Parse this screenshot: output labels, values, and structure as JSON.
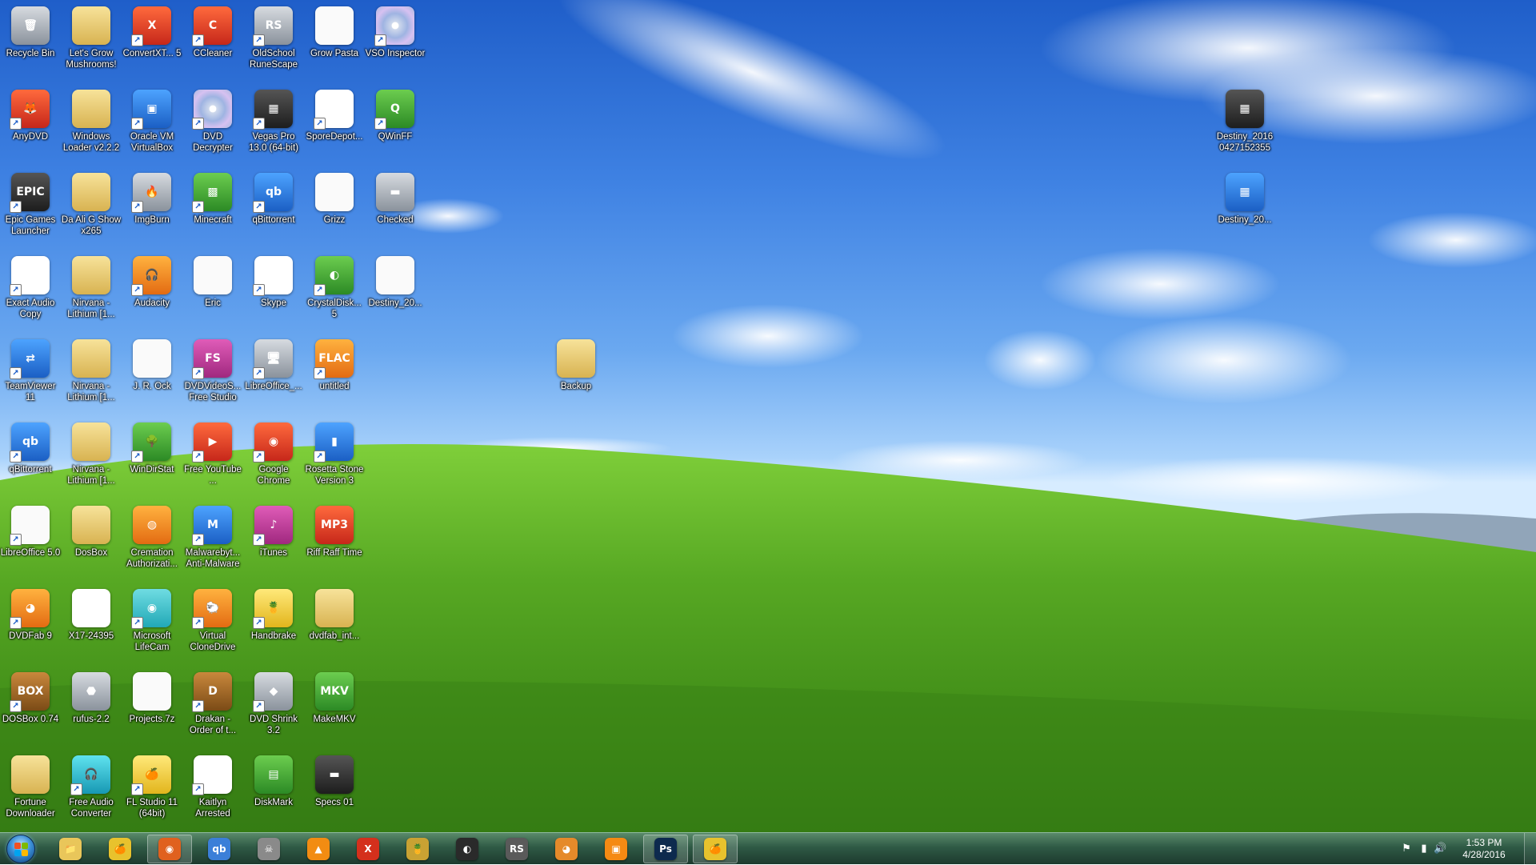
{
  "desktop": {
    "icons": [
      {
        "label": "Recycle Bin",
        "glyph": "🗑",
        "style": "gray",
        "shortcut": false
      },
      {
        "label": "Let's Grow Mushrooms!",
        "glyph": "",
        "style": "folder",
        "shortcut": false
      },
      {
        "label": "ConvertXT... 5",
        "glyph": "X",
        "style": "red",
        "shortcut": true
      },
      {
        "label": "CCleaner",
        "glyph": "C",
        "style": "red",
        "shortcut": true
      },
      {
        "label": "OldSchool RuneScape",
        "glyph": "RS",
        "style": "gray",
        "shortcut": true
      },
      {
        "label": "Grow Pasta",
        "glyph": "",
        "style": "file",
        "shortcut": false
      },
      {
        "label": "VSO Inspector",
        "glyph": "",
        "style": "disc",
        "shortcut": true
      },
      {
        "label": "AnyDVD",
        "glyph": "🦊",
        "style": "red",
        "shortcut": true
      },
      {
        "label": "Windows Loader v2.2.2",
        "glyph": "",
        "style": "folder",
        "shortcut": false
      },
      {
        "label": "Oracle VM VirtualBox",
        "glyph": "▣",
        "style": "blue",
        "shortcut": true
      },
      {
        "label": "DVD Decrypter",
        "glyph": "",
        "style": "disc",
        "shortcut": true
      },
      {
        "label": "Vegas Pro 13.0 (64-bit)",
        "glyph": "▦",
        "style": "dark",
        "shortcut": true
      },
      {
        "label": "SporeDepot...",
        "glyph": "✎",
        "style": "white",
        "shortcut": true
      },
      {
        "label": "QWinFF",
        "glyph": "Q",
        "style": "green",
        "shortcut": true
      },
      {
        "label": "Epic Games Launcher",
        "glyph": "EPIC",
        "style": "dark",
        "shortcut": true
      },
      {
        "label": "Da Ali G Show x265",
        "glyph": "",
        "style": "folder",
        "shortcut": false
      },
      {
        "label": "ImgBurn",
        "glyph": "🔥",
        "style": "gray",
        "shortcut": true
      },
      {
        "label": "Minecraft",
        "glyph": "▩",
        "style": "green",
        "shortcut": true
      },
      {
        "label": "qBittorrent",
        "glyph": "qb",
        "style": "blue",
        "shortcut": true
      },
      {
        "label": "Grizz",
        "glyph": "",
        "style": "file",
        "shortcut": false
      },
      {
        "label": "Checked",
        "glyph": "▬",
        "style": "gray",
        "shortcut": false
      },
      {
        "label": "Exact Audio Copy",
        "glyph": "EAC",
        "style": "white",
        "shortcut": true
      },
      {
        "label": "Nirvana - Lithium [1...",
        "glyph": "",
        "style": "folder",
        "shortcut": false
      },
      {
        "label": "Audacity",
        "glyph": "🎧",
        "style": "orange",
        "shortcut": true
      },
      {
        "label": "Eric",
        "glyph": "",
        "style": "file",
        "shortcut": false
      },
      {
        "label": "Skype",
        "glyph": "▦",
        "style": "white",
        "shortcut": true
      },
      {
        "label": "CrystalDisk... 5",
        "glyph": "◐",
        "style": "green",
        "shortcut": true
      },
      {
        "label": "Destiny_20...",
        "glyph": "",
        "style": "file",
        "shortcut": false
      },
      {
        "label": "TeamViewer 11",
        "glyph": "⇄",
        "style": "blue",
        "shortcut": true
      },
      {
        "label": "Nirvana - Lithium [1...",
        "glyph": "",
        "style": "folder",
        "shortcut": false
      },
      {
        "label": "J. R. Ock",
        "glyph": "",
        "style": "file",
        "shortcut": false
      },
      {
        "label": "DVDVideoS... Free Studio",
        "glyph": "FS",
        "style": "purple",
        "shortcut": true
      },
      {
        "label": "LibreOffice_...",
        "glyph": "🖥",
        "style": "gray",
        "shortcut": true
      },
      {
        "label": "untitled",
        "glyph": "FLAC",
        "style": "orange",
        "shortcut": true
      },
      {
        "label": "qBittorrent",
        "glyph": "qb",
        "style": "blue",
        "shortcut": true
      },
      {
        "label": "Nirvana - Lithium [1...",
        "glyph": "",
        "style": "folder",
        "shortcut": false
      },
      {
        "label": "WinDirStat",
        "glyph": "🌳",
        "style": "green",
        "shortcut": true
      },
      {
        "label": "Free YouTube ...",
        "glyph": "▶",
        "style": "red",
        "shortcut": true
      },
      {
        "label": "Google Chrome",
        "glyph": "◉",
        "style": "red",
        "shortcut": true
      },
      {
        "label": "Rosetta Stone Version 3",
        "glyph": "▮",
        "style": "blue",
        "shortcut": true
      },
      {
        "label": "LibreOffice 5.0",
        "glyph": "",
        "style": "file",
        "shortcut": true
      },
      {
        "label": "DosBox",
        "glyph": "",
        "style": "folder",
        "shortcut": false
      },
      {
        "label": "Cremation Authorizati...",
        "glyph": "◍",
        "style": "orange",
        "shortcut": false
      },
      {
        "label": "Malwarebyt... Anti-Malware",
        "glyph": "M",
        "style": "blue",
        "shortcut": true
      },
      {
        "label": "iTunes",
        "glyph": "♪",
        "style": "purple",
        "shortcut": true
      },
      {
        "label": "Riff Raff Time",
        "glyph": "MP3",
        "style": "red",
        "shortcut": false
      },
      {
        "label": "DVDFab 9",
        "glyph": "◕",
        "style": "orange",
        "shortcut": true
      },
      {
        "label": "X17-24395",
        "glyph": "◎",
        "style": "white",
        "shortcut": false
      },
      {
        "label": "Microsoft LifeCam",
        "glyph": "◉",
        "style": "teal",
        "shortcut": true
      },
      {
        "label": "Virtual CloneDrive",
        "glyph": "🐑",
        "style": "orange",
        "shortcut": true
      },
      {
        "label": "Handbrake",
        "glyph": "🍍",
        "style": "yellow",
        "shortcut": true
      },
      {
        "label": "dvdfab_int...",
        "glyph": "",
        "style": "folder",
        "shortcut": false
      },
      {
        "label": "DOSBox 0.74",
        "glyph": "BOX",
        "style": "brown",
        "shortcut": true
      },
      {
        "label": "rufus-2.2",
        "glyph": "⬣",
        "style": "gray",
        "shortcut": false
      },
      {
        "label": "Projects.7z",
        "glyph": "",
        "style": "file",
        "shortcut": false
      },
      {
        "label": "Drakan - Order of t...",
        "glyph": "D",
        "style": "brown",
        "shortcut": true
      },
      {
        "label": "DVD Shrink 3.2",
        "glyph": "◆",
        "style": "gray",
        "shortcut": true
      },
      {
        "label": "MakeMKV",
        "glyph": "MKV",
        "style": "green",
        "shortcut": false
      },
      {
        "label": "Fortune Downloader",
        "glyph": "",
        "style": "folder",
        "shortcut": false
      },
      {
        "label": "Free Audio Converter",
        "glyph": "🎧",
        "style": "cyan",
        "shortcut": true
      },
      {
        "label": "FL Studio 11 (64bit)",
        "glyph": "🍊",
        "style": "yellow",
        "shortcut": true
      },
      {
        "label": "Kaitlyn Arrested",
        "glyph": "✦",
        "style": "white",
        "shortcut": true
      },
      {
        "label": "DiskMark",
        "glyph": "▤",
        "style": "green",
        "shortcut": false
      },
      {
        "label": "Specs 01",
        "glyph": "▬",
        "style": "dark",
        "shortcut": false
      },
      {
        "label": "Backup",
        "glyph": "",
        "style": "folder",
        "shortcut": false
      },
      {
        "label": "Destiny_2016 0427152355",
        "glyph": "▦",
        "style": "dark",
        "shortcut": false
      },
      {
        "label": "Destiny_20...",
        "glyph": "▦",
        "style": "blue",
        "shortcut": false
      }
    ]
  },
  "taskbar": {
    "start_label": "Start",
    "buttons": [
      {
        "name": "taskbar-explorer",
        "glyph": "📁",
        "color": "#e9c65a",
        "active": false
      },
      {
        "name": "taskbar-fl-studio",
        "glyph": "🍊",
        "color": "#e8c22d",
        "active": false
      },
      {
        "name": "taskbar-firefox",
        "glyph": "◉",
        "color": "#e0611e",
        "active": true
      },
      {
        "name": "taskbar-qbittorrent",
        "glyph": "qb",
        "color": "#3b7fd8",
        "active": false
      },
      {
        "name": "taskbar-flac",
        "glyph": "☠",
        "color": "#8a8a8a",
        "active": false
      },
      {
        "name": "taskbar-vlc",
        "glyph": "▲",
        "color": "#f28c12",
        "active": false
      },
      {
        "name": "taskbar-convertx",
        "glyph": "X",
        "color": "#d4301c",
        "active": false
      },
      {
        "name": "taskbar-handbrake",
        "glyph": "🍍",
        "color": "#c9a233",
        "active": false
      },
      {
        "name": "taskbar-obs",
        "glyph": "◐",
        "color": "#2a2a2a",
        "active": false
      },
      {
        "name": "taskbar-runescape",
        "glyph": "RS",
        "color": "#5a5a5a",
        "active": false
      },
      {
        "name": "taskbar-dvdfab",
        "glyph": "◕",
        "color": "#e58a2a",
        "active": false
      },
      {
        "name": "taskbar-media",
        "glyph": "▣",
        "color": "#f58a13",
        "active": false
      },
      {
        "name": "taskbar-photoshop",
        "glyph": "Ps",
        "color": "#0d2a4e",
        "active": true
      },
      {
        "name": "taskbar-fl-studio-2",
        "glyph": "🍊",
        "color": "#e8c22d",
        "active": true
      }
    ],
    "clock": {
      "time": "1:53 PM",
      "date": "4/28/2016"
    }
  },
  "colors": {
    "sky_top": "#1f5ec9",
    "grass": "#4f9e1f",
    "taskbar": "#2f5a45"
  }
}
